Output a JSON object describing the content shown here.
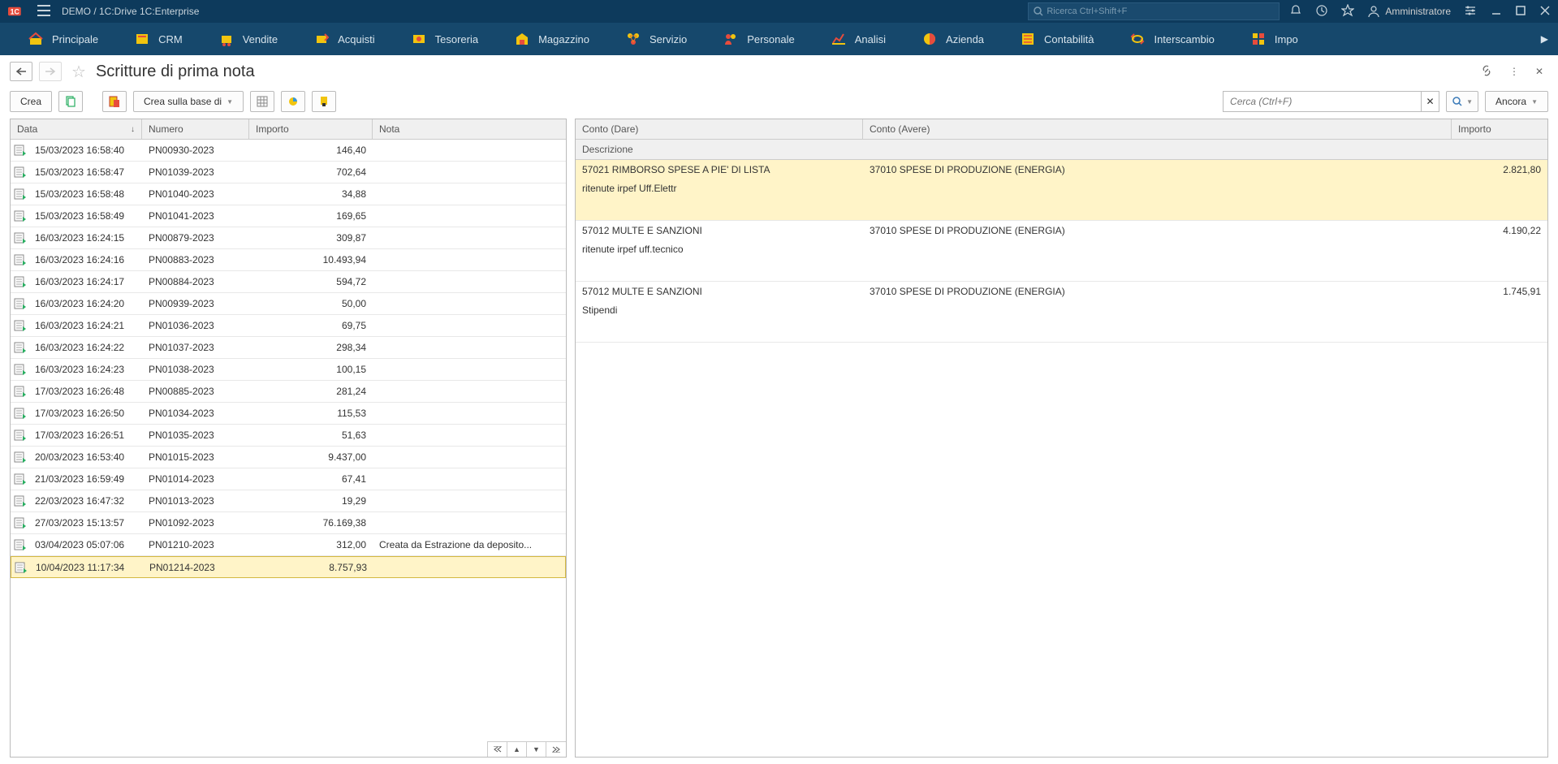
{
  "titlebar": {
    "app_title": "DEMO / 1C:Drive 1C:Enterprise",
    "search_placeholder": "Ricerca Ctrl+Shift+F",
    "user_label": "Amministratore"
  },
  "mainmenu": [
    {
      "label": "Principale",
      "icon": "home"
    },
    {
      "label": "CRM",
      "icon": "crm"
    },
    {
      "label": "Vendite",
      "icon": "sale"
    },
    {
      "label": "Acquisti",
      "icon": "buy"
    },
    {
      "label": "Tesoreria",
      "icon": "treasury"
    },
    {
      "label": "Magazzino",
      "icon": "warehouse"
    },
    {
      "label": "Servizio",
      "icon": "service"
    },
    {
      "label": "Personale",
      "icon": "hr"
    },
    {
      "label": "Analisi",
      "icon": "analysis"
    },
    {
      "label": "Azienda",
      "icon": "company"
    },
    {
      "label": "Contabilità",
      "icon": "accounting"
    },
    {
      "label": "Interscambio",
      "icon": "exchange"
    },
    {
      "label": "Impo",
      "icon": "settings"
    }
  ],
  "page": {
    "title": "Scritture di prima nota"
  },
  "toolbar": {
    "crea": "Crea",
    "crea_base": "Crea sulla base di",
    "search_placeholder": "Cerca (Ctrl+F)",
    "ancora": "Ancora"
  },
  "left_headers": {
    "data": "Data",
    "numero": "Numero",
    "importo": "Importo",
    "nota": "Nota"
  },
  "rows": [
    {
      "date": "15/03/2023 16:58:40",
      "num": "PN00930-2023",
      "amt": "146,40",
      "note": ""
    },
    {
      "date": "15/03/2023 16:58:47",
      "num": "PN01039-2023",
      "amt": "702,64",
      "note": ""
    },
    {
      "date": "15/03/2023 16:58:48",
      "num": "PN01040-2023",
      "amt": "34,88",
      "note": ""
    },
    {
      "date": "15/03/2023 16:58:49",
      "num": "PN01041-2023",
      "amt": "169,65",
      "note": ""
    },
    {
      "date": "16/03/2023 16:24:15",
      "num": "PN00879-2023",
      "amt": "309,87",
      "note": ""
    },
    {
      "date": "16/03/2023 16:24:16",
      "num": "PN00883-2023",
      "amt": "10.493,94",
      "note": ""
    },
    {
      "date": "16/03/2023 16:24:17",
      "num": "PN00884-2023",
      "amt": "594,72",
      "note": ""
    },
    {
      "date": "16/03/2023 16:24:20",
      "num": "PN00939-2023",
      "amt": "50,00",
      "note": ""
    },
    {
      "date": "16/03/2023 16:24:21",
      "num": "PN01036-2023",
      "amt": "69,75",
      "note": ""
    },
    {
      "date": "16/03/2023 16:24:22",
      "num": "PN01037-2023",
      "amt": "298,34",
      "note": ""
    },
    {
      "date": "16/03/2023 16:24:23",
      "num": "PN01038-2023",
      "amt": "100,15",
      "note": ""
    },
    {
      "date": "17/03/2023 16:26:48",
      "num": "PN00885-2023",
      "amt": "281,24",
      "note": ""
    },
    {
      "date": "17/03/2023 16:26:50",
      "num": "PN01034-2023",
      "amt": "115,53",
      "note": ""
    },
    {
      "date": "17/03/2023 16:26:51",
      "num": "PN01035-2023",
      "amt": "51,63",
      "note": ""
    },
    {
      "date": "20/03/2023 16:53:40",
      "num": "PN01015-2023",
      "amt": "9.437,00",
      "note": ""
    },
    {
      "date": "21/03/2023 16:59:49",
      "num": "PN01014-2023",
      "amt": "67,41",
      "note": ""
    },
    {
      "date": "22/03/2023 16:47:32",
      "num": "PN01013-2023",
      "amt": "19,29",
      "note": ""
    },
    {
      "date": "27/03/2023 15:13:57",
      "num": "PN01092-2023",
      "amt": "76.169,38",
      "note": ""
    },
    {
      "date": "03/04/2023 05:07:06",
      "num": "PN01210-2023",
      "amt": "312,00",
      "note": "Creata da Estrazione da deposito..."
    },
    {
      "date": "10/04/2023 11:17:34",
      "num": "PN01214-2023",
      "amt": "8.757,93",
      "note": "",
      "sel": true
    }
  ],
  "right_headers": {
    "dare": "Conto (Dare)",
    "avere": "Conto (Avere)",
    "importo": "Importo",
    "descrizione": "Descrizione"
  },
  "details": [
    {
      "dare": "57021 RIMBORSO SPESE A PIE' DI LISTA",
      "avere": "37010 SPESE DI PRODUZIONE (ENERGIA)",
      "imp": "2.821,80",
      "desc": "ritenute irpef Uff.Elettr",
      "sel": true
    },
    {
      "dare": "57012 MULTE  E SANZIONI",
      "avere": "37010 SPESE DI PRODUZIONE (ENERGIA)",
      "imp": "4.190,22",
      "desc": "ritenute irpef uff.tecnico"
    },
    {
      "dare": "57012 MULTE  E SANZIONI",
      "avere": "37010 SPESE DI PRODUZIONE (ENERGIA)",
      "imp": "1.745,91",
      "desc": "Stipendi"
    }
  ]
}
